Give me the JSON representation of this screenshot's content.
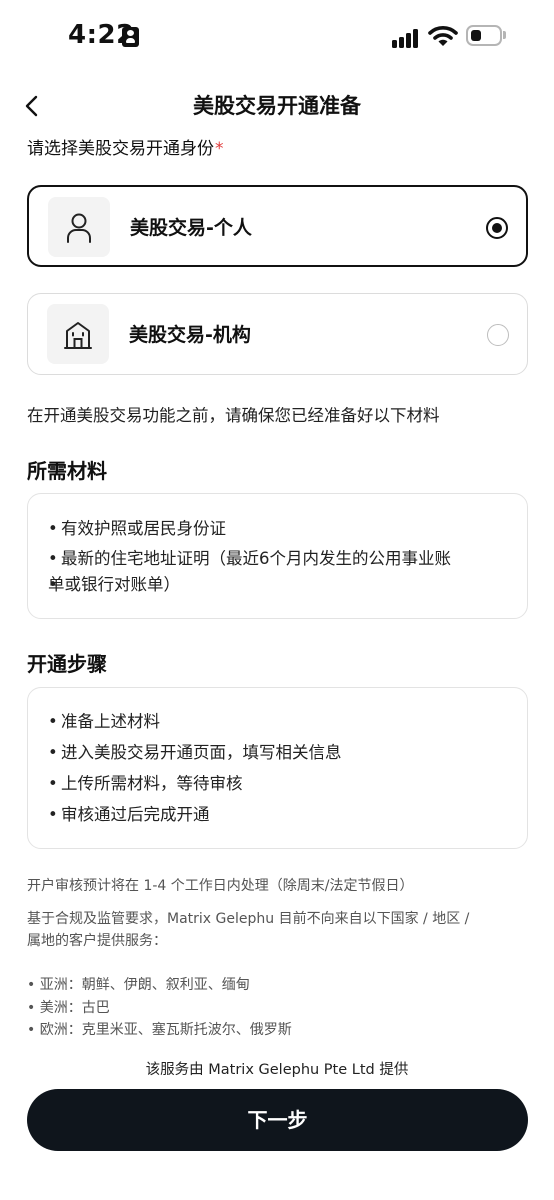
{
  "status_bar": {
    "time": "4:22"
  },
  "header": {
    "title": "美股交易开通准备"
  },
  "identity": {
    "prompt": "请选择美股交易开通身份",
    "required_mark": "*",
    "options": [
      {
        "label": "美股交易-个人",
        "icon": "person-icon",
        "selected": true
      },
      {
        "label": "美股交易-机构",
        "icon": "building-icon",
        "selected": false
      }
    ]
  },
  "intro": "在开通美股交易功能之前，请确保您已经准备好以下材料",
  "materials": {
    "title": "所需材料",
    "items": [
      "有效护照或居民身份证",
      "最新的住宅地址证明（最近6个月内发生的公用事业账",
      "单或银行对账单）"
    ]
  },
  "steps": {
    "title": "开通步骤",
    "items": [
      "准备上述材料",
      "进入美股交易开通页面，填写相关信息",
      "上传所需材料，等待审核",
      "审核通过后完成开通"
    ]
  },
  "notes": {
    "processing": "开户审核预计将在 1-4 个工作日内处理（除周末/法定节假日）",
    "compliance_line1": "基于合规及监管要求，Matrix Gelephu 目前不向来自以下国家 / 地区 /",
    "compliance_line2": "属地的客户提供服务：",
    "regions": [
      "• 亚洲：朝鲜、伊朗、叙利亚、缅甸",
      "• 美洲：古巴",
      "• 欧洲：克里米亚、塞瓦斯托波尔、俄罗斯"
    ]
  },
  "provider": "该服务由 Matrix Gelephu Pte Ltd 提供",
  "next_button": "下一步",
  "colors": {
    "primary": "#0f151c",
    "required": "#e03a3a",
    "card_border": "#e3e3e3"
  }
}
